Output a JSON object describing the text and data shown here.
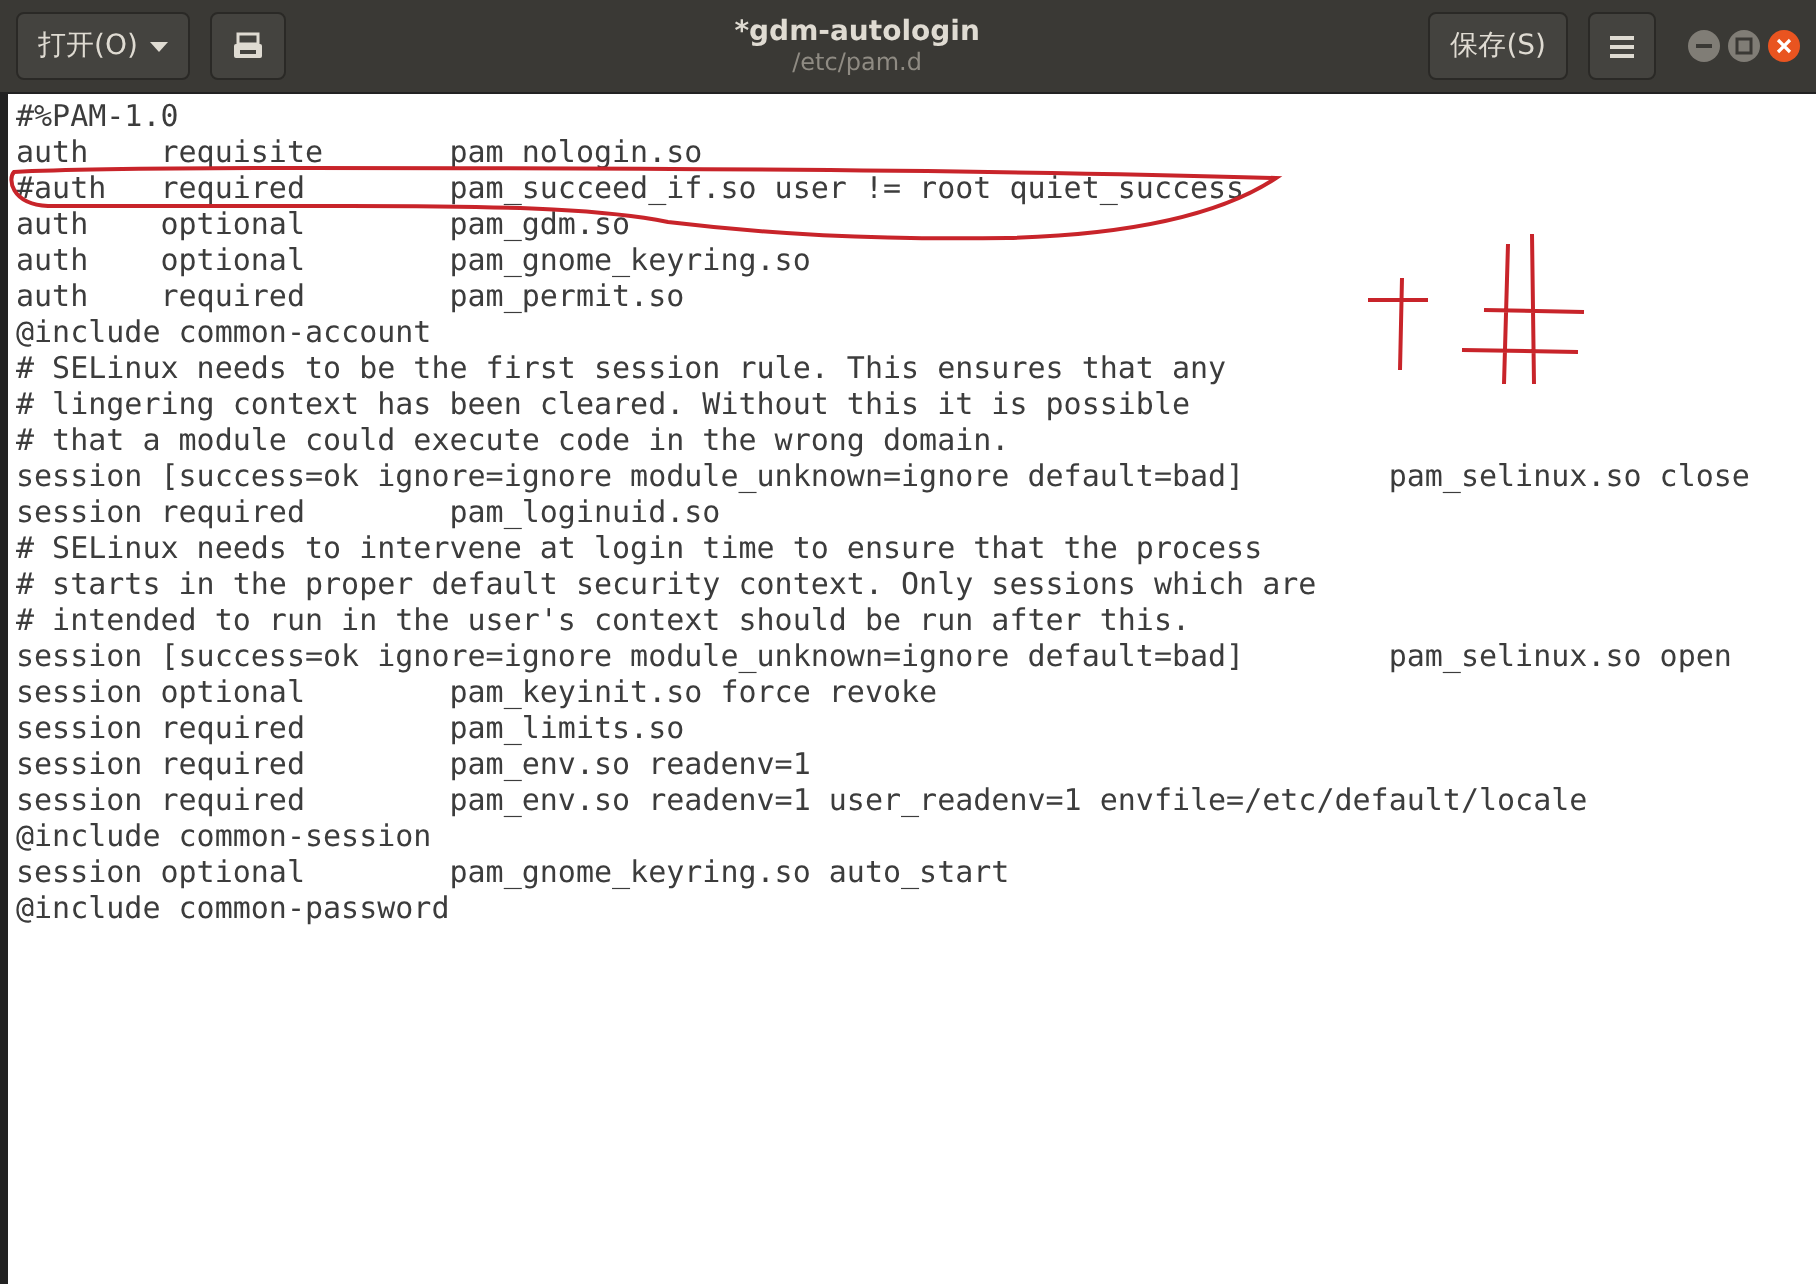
{
  "header_bar": {
    "open_button": "打开(O)",
    "title": "*gdm-autologin",
    "subtitle": "/etc/pam.d",
    "save_button": "保存(S)"
  },
  "editor": {
    "lines": [
      "#%PAM-1.0",
      "auth    requisite       pam_nologin.so",
      "#auth   required        pam_succeed_if.so user != root quiet_success",
      "auth    optional        pam_gdm.so",
      "auth    optional        pam_gnome_keyring.so",
      "auth    required        pam_permit.so",
      "@include common-account",
      "# SELinux needs to be the first session rule. This ensures that any",
      "# lingering context has been cleared. Without this it is possible",
      "# that a module could execute code in the wrong domain.",
      "session [success=ok ignore=ignore module_unknown=ignore default=bad]        pam_selinux.so close",
      "session required        pam_loginuid.so",
      "# SELinux needs to intervene at login time to ensure that the process",
      "# starts in the proper default security context. Only sessions which are",
      "# intended to run in the user's context should be run after this.",
      "session [success=ok ignore=ignore module_unknown=ignore default=bad]        pam_selinux.so open",
      "session optional        pam_keyinit.so force revoke",
      "session required        pam_limits.so",
      "session required        pam_env.so readenv=1",
      "session required        pam_env.so readenv=1 user_readenv=1 envfile=/etc/default/locale",
      "@include common-session",
      "session optional        pam_gnome_keyring.so auto_start",
      "@include common-password"
    ]
  }
}
